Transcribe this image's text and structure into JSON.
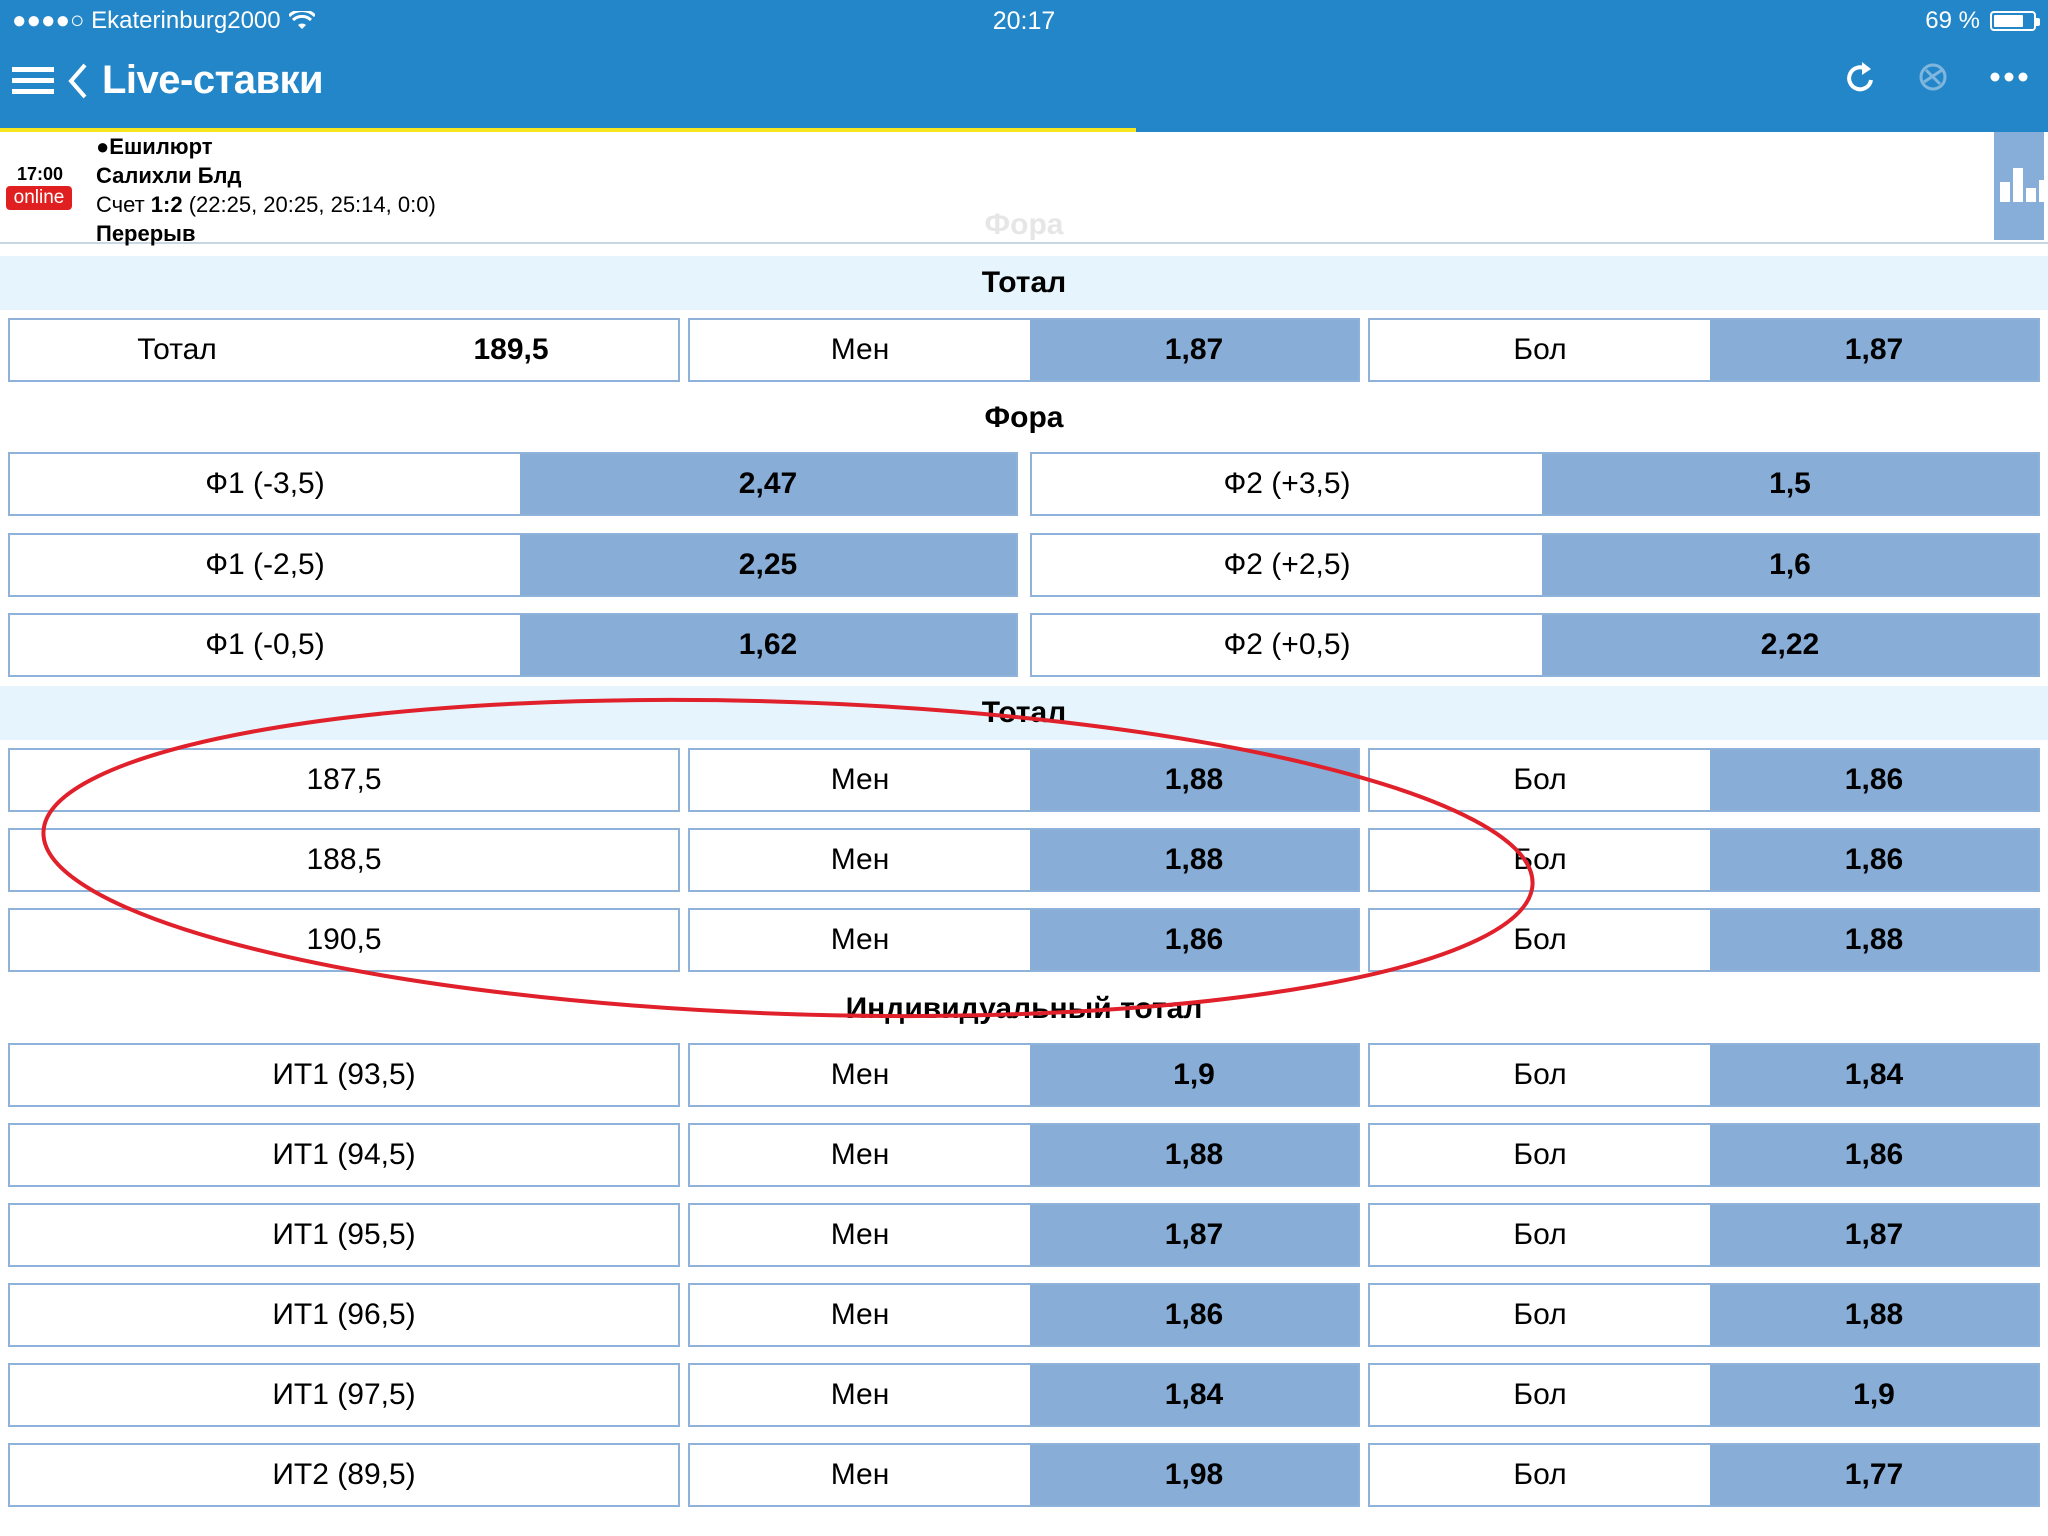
{
  "status_bar": {
    "carrier": "●●●●○ Ekaterinburg2000",
    "time": "20:17",
    "battery": "69 %"
  },
  "nav": {
    "title": "Live-ставки",
    "icons": [
      "menu-icon",
      "back-chevron-icon",
      "refresh-icon",
      "broadcast-icon",
      "more-icon"
    ]
  },
  "match": {
    "time": "17:00",
    "online_label": "online",
    "team1": "●Ешилюрт",
    "team2": "Салихли Блд",
    "score_prefix": "Счет ",
    "score": "1:2",
    "score_detail": " (22:25, 20:25, 25:14, 0:0)",
    "status": "Перерыв",
    "ghost_heading": "Фора"
  },
  "sections": {
    "total_main": {
      "heading": "Тотал",
      "row": {
        "label": "Тотал",
        "value": "189,5",
        "under": "Мен",
        "under_odd": "1,87",
        "over": "Бол",
        "over_odd": "1,87"
      }
    },
    "handicap": {
      "heading": "Фора",
      "rows": [
        {
          "f1": "Ф1 (-3,5)",
          "f1_odd": "2,47",
          "f2": "Ф2 (+3,5)",
          "f2_odd": "1,5"
        },
        {
          "f1": "Ф1 (-2,5)",
          "f1_odd": "2,25",
          "f2": "Ф2 (+2,5)",
          "f2_odd": "1,6"
        },
        {
          "f1": "Ф1 (-0,5)",
          "f1_odd": "1,62",
          "f2": "Ф2 (+0,5)",
          "f2_odd": "2,22"
        }
      ]
    },
    "total_alt": {
      "heading": "Тотал",
      "rows": [
        {
          "label": "187,5",
          "under": "Мен",
          "under_odd": "1,88",
          "over": "Бол",
          "over_odd": "1,86"
        },
        {
          "label": "188,5",
          "under": "Мен",
          "under_odd": "1,88",
          "over": "Бол",
          "over_odd": "1,86"
        },
        {
          "label": "190,5",
          "under": "Мен",
          "under_odd": "1,86",
          "over": "Бол",
          "over_odd": "1,88"
        }
      ]
    },
    "individual_total": {
      "heading": "Индивидуальный тотал",
      "rows": [
        {
          "label": "ИТ1 (93,5)",
          "under": "Мен",
          "under_odd": "1,9",
          "over": "Бол",
          "over_odd": "1,84"
        },
        {
          "label": "ИТ1 (94,5)",
          "under": "Мен",
          "under_odd": "1,88",
          "over": "Бол",
          "over_odd": "1,86"
        },
        {
          "label": "ИТ1 (95,5)",
          "under": "Мен",
          "under_odd": "1,87",
          "over": "Бол",
          "over_odd": "1,87"
        },
        {
          "label": "ИТ1 (96,5)",
          "under": "Мен",
          "under_odd": "1,86",
          "over": "Бол",
          "over_odd": "1,88"
        },
        {
          "label": "ИТ1 (97,5)",
          "under": "Мен",
          "under_odd": "1,84",
          "over": "Бол",
          "over_odd": "1,9"
        },
        {
          "label": "ИТ2 (89,5)",
          "under": "Мен",
          "under_odd": "1,98",
          "over": "Бол",
          "over_odd": "1,77"
        }
      ]
    }
  },
  "colors": {
    "header_blue": "#2386c8",
    "progress_yellow": "#f5e620",
    "odd_cell": "#88aed8",
    "cell_border": "#8eb2d9",
    "section_light": "#e6f4fd",
    "online_red": "#e02020",
    "annotation_red": "#e0202a"
  }
}
